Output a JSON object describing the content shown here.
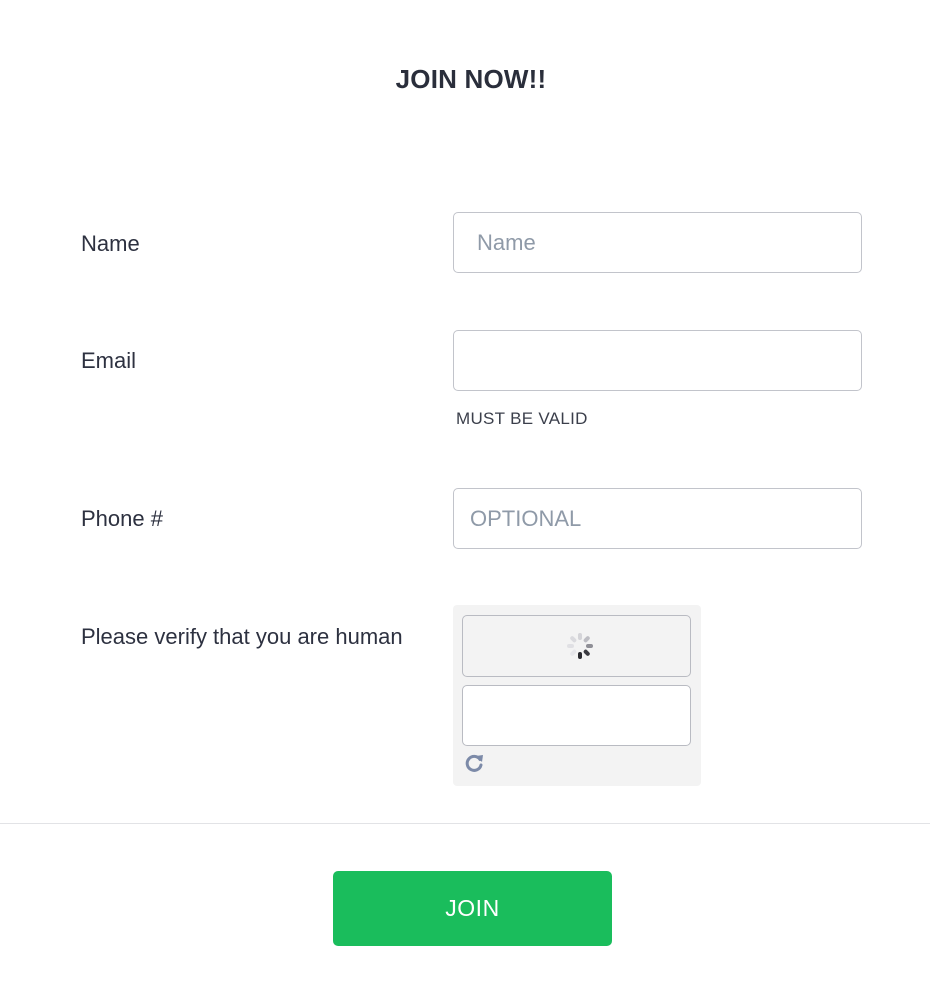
{
  "form": {
    "title": "JOIN NOW!!",
    "name": {
      "label": "Name",
      "value": "",
      "placeholder": "Name"
    },
    "email": {
      "label": "Email",
      "value": "",
      "placeholder": "",
      "hint": "MUST BE VALID"
    },
    "phone": {
      "label": "Phone #",
      "value": "",
      "placeholder": "OPTIONAL"
    },
    "captcha": {
      "label": "Please verify that you are human",
      "state": "loading",
      "answer_value": "",
      "refresh_icon": "refresh-icon",
      "spinner_icon": "loading-spinner-icon"
    },
    "submit_label": "JOIN"
  },
  "colors": {
    "accent": "#1abd5c",
    "text": "#2d3140",
    "placeholder": "#8f9aa8",
    "border": "#c2c4cb",
    "captcha_bg": "#f3f3f3"
  }
}
